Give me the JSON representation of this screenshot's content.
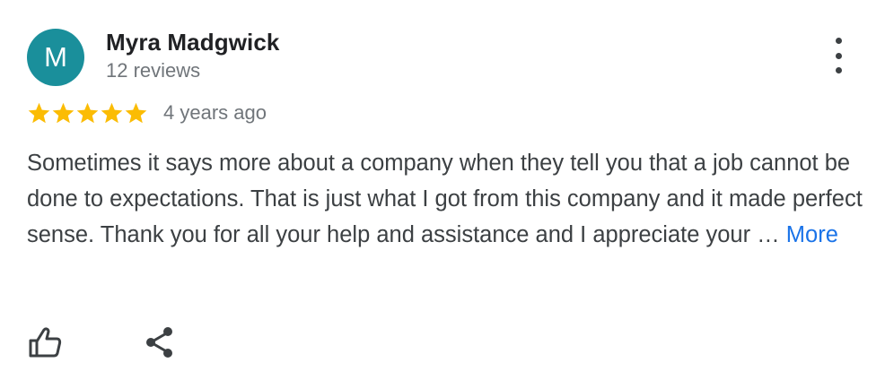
{
  "reviewer": {
    "initial": "M",
    "name": "Myra Madgwick",
    "reviews_count": "12 reviews",
    "avatar_color": "#1a8f9b"
  },
  "rating": {
    "stars": 5,
    "max_stars": 5,
    "star_color": "#fbbc04",
    "date": "4 years ago"
  },
  "review": {
    "text": "Sometimes it says more about a company when they tell you that a job cannot be done to expectations. That is just what I got from this company and it made perfect sense. Thank you for all your help and assistance and I appreciate your …",
    "more_label": "More",
    "link_color": "#1a73e8"
  },
  "actions": {
    "like_icon": "thumbs-up-icon",
    "share_icon": "share-icon",
    "menu_icon": "more-vert-icon"
  }
}
